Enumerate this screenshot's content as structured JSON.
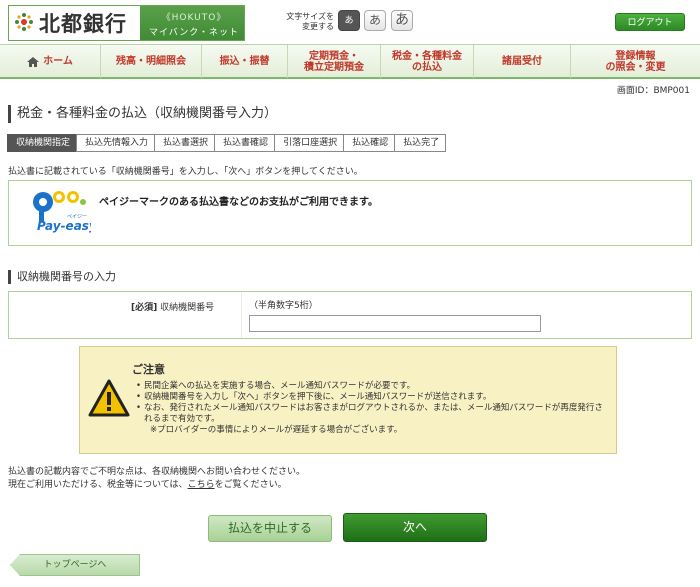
{
  "header": {
    "logo_text": "北都銀行",
    "logo_hokuto": "《HOKUTO》",
    "logo_sub": "マイバンク・ネット",
    "font_size_label": "文字サイズを変更する",
    "font_sizes": [
      "あ",
      "あ",
      "あ"
    ],
    "logout": "ログアウト"
  },
  "nav": {
    "items": [
      {
        "label": "ホーム",
        "icon": "home-icon"
      },
      {
        "label": "残高・明細照会"
      },
      {
        "label": "振込・振替"
      },
      {
        "label": "定期預金・\n積立定期預金"
      },
      {
        "label": "税金・各種料金\nの払込"
      },
      {
        "label": "諸届受付"
      },
      {
        "label": "登録情報\nの照会・変更"
      }
    ]
  },
  "screen_id": "画面ID：BMP001",
  "page_title": "税金・各種料金の払込（収納機関番号入力）",
  "steps": [
    "収納機関指定",
    "払込先情報入力",
    "払込書選択",
    "払込書確認",
    "引落口座選択",
    "払込確認",
    "払込完了"
  ],
  "intro": "払込書に記載されている「収納機関番号」を入力し、「次へ」ボタンを押してください。",
  "payeasy": {
    "logo_label": "Pay-easy",
    "logo_kana": "ペイジー",
    "message": "ペイジーマークのある払込書などのお支払がご利用できます。"
  },
  "section_title": "収納機関番号の入力",
  "form": {
    "required": "[必須]",
    "label": "収納機関番号",
    "hint": "（半角数字5桁）",
    "value": ""
  },
  "caution": {
    "title": "ご注意",
    "items": [
      "民間企業への払込を実施する場合、メール通知パスワードが必要です。",
      "収納機関番号を入力し「次へ」ボタンを押下後に、メール通知パスワードが送信されます。",
      "なお、発行されたメール通知パスワードはお客さまがログアウトされるか、または、メール通知パスワードが再度発行されるまで有効です。"
    ],
    "note": "※プロバイダーの事情によりメールが遅延する場合がございます。"
  },
  "footer": {
    "line1": "払込書の記載内容でご不明な点は、各収納機関へお問い合わせください。",
    "line2_pre": "現在ご利用いただける、税金等については、",
    "line2_link": "こちら",
    "line2_post": "をご覧ください。"
  },
  "buttons": {
    "cancel": "払込を中止する",
    "next": "次へ",
    "top": "トップページへ"
  },
  "colors": {
    "brand_green": "#3f8a35",
    "nav_text": "#c0392b",
    "caution_bg": "#f8f1c4"
  }
}
